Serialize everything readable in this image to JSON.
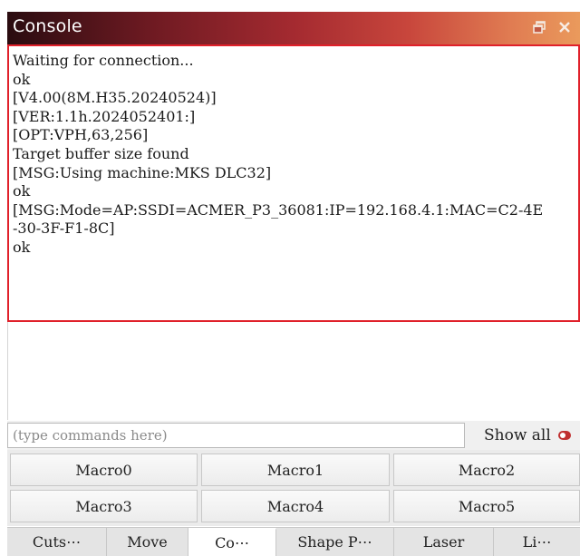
{
  "window": {
    "title": "Console",
    "float_icon": "float-window-icon",
    "close_icon": "close-icon",
    "colors": {
      "titlebar_start": "#2a0c10",
      "titlebar_end": "#ea9a5c",
      "highlight_border": "#e0202a"
    }
  },
  "console": {
    "lines": [
      "Waiting for connection...",
      "ok",
      "[V4.00(8M.H35.20240524)]",
      "[VER:1.1h.2024052401:]",
      "[OPT:VPH,63,256]",
      "Target buffer size found",
      "[MSG:Using machine:MKS DLC32]",
      "ok",
      "[MSG:Mode=AP:SSDI=ACMER_P3_36081:IP=192.168.4.1:MAC=C2-4E",
      "-30-3F-F1-8C]",
      "ok"
    ]
  },
  "command": {
    "placeholder": "(type commands here)",
    "value": "",
    "show_all_label": "Show all"
  },
  "macros": [
    "Macro0",
    "Macro1",
    "Macro2",
    "Macro3",
    "Macro4",
    "Macro5"
  ],
  "tabs": [
    {
      "label": "Cuts⋯",
      "active": false
    },
    {
      "label": "Move",
      "active": false
    },
    {
      "label": "Co⋯",
      "active": true
    },
    {
      "label": "Shape P⋯",
      "active": false
    },
    {
      "label": "Laser",
      "active": false
    },
    {
      "label": "Li⋯",
      "active": false
    }
  ]
}
